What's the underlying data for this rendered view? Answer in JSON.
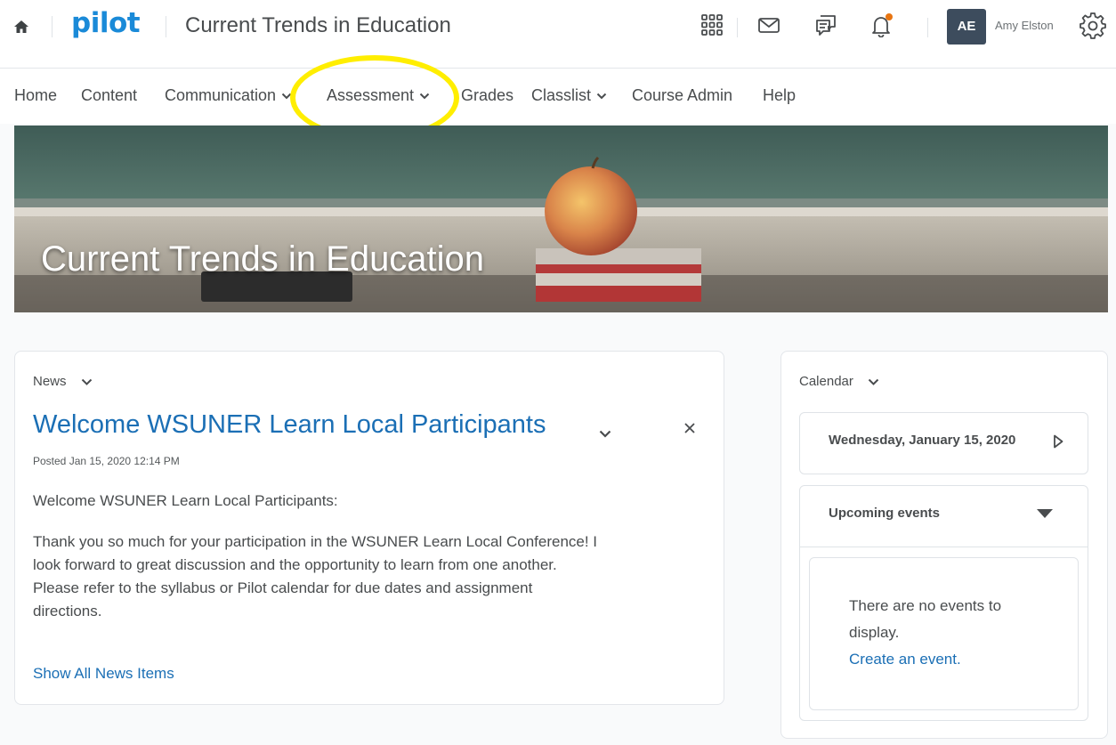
{
  "header": {
    "logo": "pilot",
    "course_title": "Current Trends in Education",
    "avatar_initials": "AE",
    "user_name": "Amy Elston",
    "icons": [
      "home-icon",
      "waffle-grid-icon",
      "mail-icon",
      "chat-icon",
      "bell-icon",
      "gear-icon"
    ],
    "notification_dot_color": "#e87511"
  },
  "nav": {
    "items": [
      {
        "label": "Home"
      },
      {
        "label": "Content"
      },
      {
        "label": "Communication",
        "dropdown": true
      },
      {
        "label": "Assessment",
        "dropdown": true
      },
      {
        "label": "Grades"
      },
      {
        "label": "Classlist",
        "dropdown": true
      },
      {
        "label": "Course Admin"
      },
      {
        "label": "Help"
      }
    ],
    "highlight_color": "#ffee00"
  },
  "banner": {
    "title": "Current Trends in Education"
  },
  "news": {
    "widget_title": "News",
    "heading": "Welcome WSUNER Learn Local Participants",
    "posted": "Posted Jan 15, 2020 12:14 PM",
    "greeting": "Welcome WSUNER Learn Local Participants:",
    "body_lines": [
      "Thank you so much for your participation in the WSUNER Learn Local Conference! I",
      "look forward to great discussion and the opportunity to learn from one another.",
      "Please refer to the syllabus or Pilot calendar for due dates and assignment",
      "directions."
    ],
    "show_all": "Show All News Items"
  },
  "calendar": {
    "widget_title": "Calendar",
    "date": "Wednesday, January 15, 2020",
    "upcoming_label": "Upcoming events",
    "empty_line1": "There are no events to",
    "empty_line2": "display.",
    "create_link": "Create an event."
  },
  "colors": {
    "link": "#1b6fb5",
    "brand": "#1a8ad8",
    "avatar_bg": "#3d4c5d"
  }
}
